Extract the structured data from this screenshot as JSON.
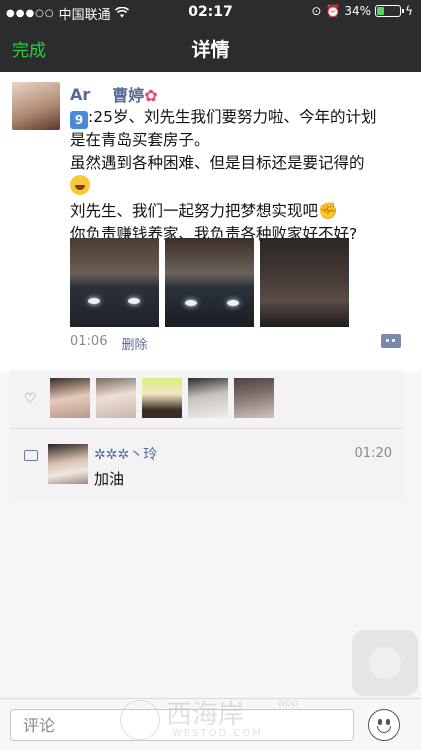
{
  "status_bar": {
    "signal_dots": "●●●○○",
    "carrier": "中国联通",
    "time": "02:17",
    "battery_percent": "34%",
    "battery_level": 0.34
  },
  "nav": {
    "done_label": "完成",
    "title": "详情"
  },
  "post": {
    "author_name": "Ar",
    "author_name_2": "曹婷",
    "line1_badge": "9",
    "line1": ":25岁、刘先生我们要努力啦、今年的计划",
    "line2": "是在青岛买套房子。",
    "line3": "虽然遇到各种困难、但是目标还是要记得的",
    "line5": "刘先生、我们一起努力把梦想实现吧",
    "line6": "你负责赚钱养家、我负责各种败家好不好?",
    "time": "01:06",
    "delete_label": "删除",
    "photo_count": 3
  },
  "likes": {
    "count": 5
  },
  "comment": {
    "name": "✲✲✲丶玲",
    "time": "01:20",
    "text": "加油"
  },
  "input": {
    "placeholder": "评论"
  },
  "watermark": {
    "title": "西海岸",
    "app": "app",
    "url": "WESTOD.COM"
  },
  "colors": {
    "link": "#576b95",
    "done_green": "#2ecc40",
    "topbar": "#2c2c2e"
  }
}
